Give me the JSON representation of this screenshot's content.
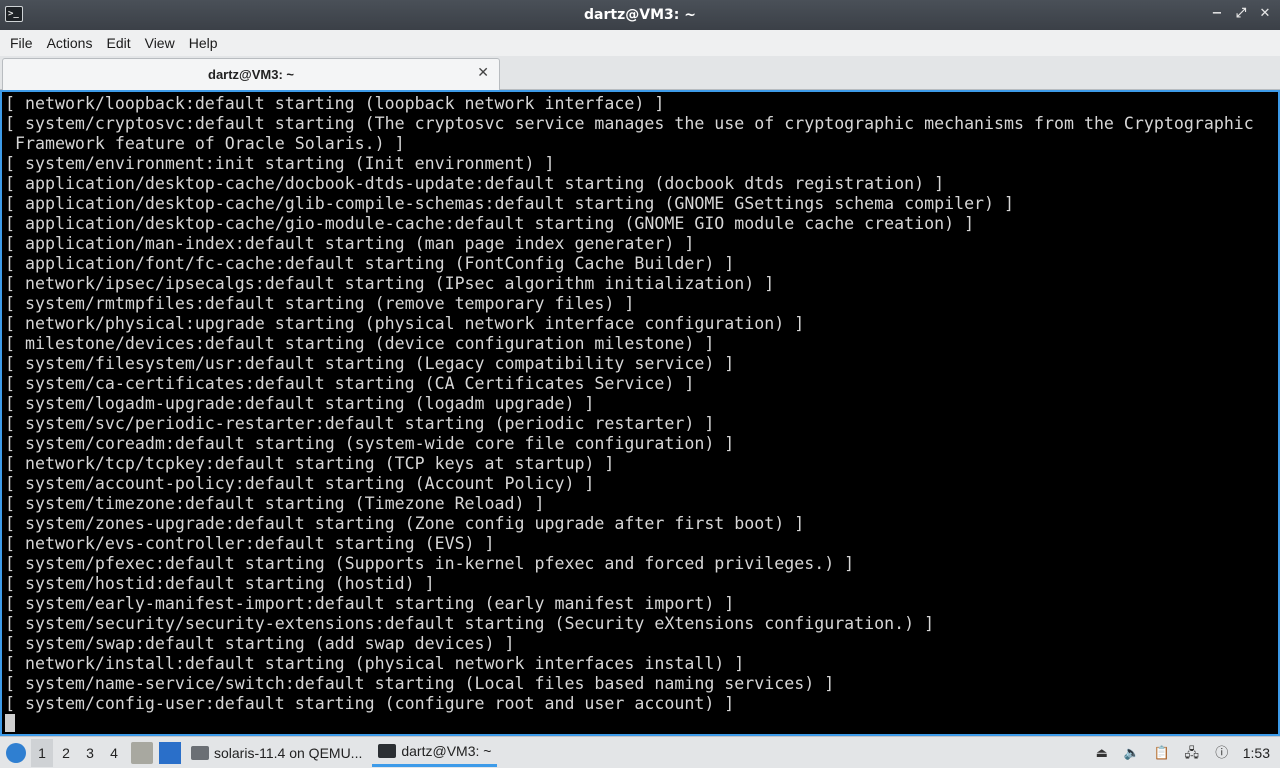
{
  "window": {
    "title": "dartz@VM3: ~",
    "app_icon_glyph": ">_",
    "controls": {
      "minimize": "−",
      "maximize": "⤢",
      "close": "✕"
    }
  },
  "menubar": {
    "items": [
      "File",
      "Actions",
      "Edit",
      "View",
      "Help"
    ]
  },
  "tab": {
    "label": "dartz@VM3: ~",
    "close_glyph": "✕"
  },
  "terminal": {
    "lines": [
      "[ network/loopback:default starting (loopback network interface) ]",
      "[ system/cryptosvc:default starting (The cryptosvc service manages the use of cryptographic mechanisms from the Cryptographic",
      " Framework feature of Oracle Solaris.) ]",
      "[ system/environment:init starting (Init environment) ]",
      "[ application/desktop-cache/docbook-dtds-update:default starting (docbook dtds registration) ]",
      "[ application/desktop-cache/glib-compile-schemas:default starting (GNOME GSettings schema compiler) ]",
      "[ application/desktop-cache/gio-module-cache:default starting (GNOME GIO module cache creation) ]",
      "[ application/man-index:default starting (man page index generater) ]",
      "[ application/font/fc-cache:default starting (FontConfig Cache Builder) ]",
      "[ network/ipsec/ipsecalgs:default starting (IPsec algorithm initialization) ]",
      "[ system/rmtmpfiles:default starting (remove temporary files) ]",
      "[ network/physical:upgrade starting (physical network interface configuration) ]",
      "[ milestone/devices:default starting (device configuration milestone) ]",
      "[ system/filesystem/usr:default starting (Legacy compatibility service) ]",
      "[ system/ca-certificates:default starting (CA Certificates Service) ]",
      "[ system/logadm-upgrade:default starting (logadm upgrade) ]",
      "[ system/svc/periodic-restarter:default starting (periodic restarter) ]",
      "[ system/coreadm:default starting (system-wide core file configuration) ]",
      "[ network/tcp/tcpkey:default starting (TCP keys at startup) ]",
      "[ system/account-policy:default starting (Account Policy) ]",
      "[ system/timezone:default starting (Timezone Reload) ]",
      "[ system/zones-upgrade:default starting (Zone config upgrade after first boot) ]",
      "[ network/evs-controller:default starting (EVS) ]",
      "[ system/pfexec:default starting (Supports in-kernel pfexec and forced privileges.) ]",
      "[ system/hostid:default starting (hostid) ]",
      "[ system/early-manifest-import:default starting (early manifest import) ]",
      "[ system/security/security-extensions:default starting (Security eXtensions configuration.) ]",
      "[ system/swap:default starting (add swap devices) ]",
      "[ network/install:default starting (physical network interfaces install) ]",
      "[ system/name-service/switch:default starting (Local files based naming services) ]",
      "[ system/config-user:default starting (configure root and user account) ]"
    ]
  },
  "taskbar": {
    "workspaces": [
      "1",
      "2",
      "3",
      "4"
    ],
    "tasks": [
      {
        "label": "solaris-11.4 on QEMU..."
      },
      {
        "label": "dartz@VM3: ~"
      }
    ],
    "clock": "1:53"
  },
  "colors": {
    "terminal_bg": "#000000",
    "terminal_fg": "#d6d6d6",
    "accent": "#3d9be9"
  }
}
